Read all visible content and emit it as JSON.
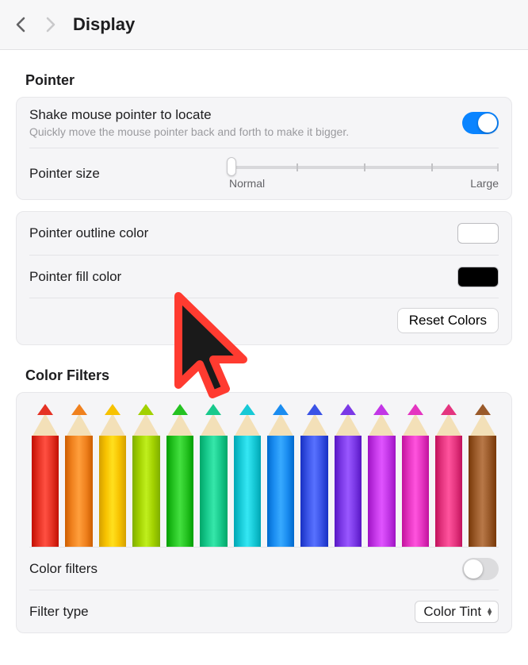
{
  "header": {
    "title": "Display"
  },
  "pointer": {
    "heading": "Pointer",
    "shake_label": "Shake mouse pointer to locate",
    "shake_sub": "Quickly move the mouse pointer back and forth to make it bigger.",
    "shake_on": true,
    "size_label": "Pointer size",
    "size_min_label": "Normal",
    "size_max_label": "Large",
    "outline_label": "Pointer outline color",
    "fill_label": "Pointer fill color",
    "reset_label": "Reset Colors"
  },
  "filters": {
    "heading": "Color Filters",
    "pencil_colors": [
      "#e53224",
      "#f0811e",
      "#f7c200",
      "#a2d100",
      "#25c221",
      "#18c98c",
      "#17c9d6",
      "#1a8cf0",
      "#3a53e6",
      "#7b39e6",
      "#c236e6",
      "#e435c0",
      "#e4357f",
      "#9a5a2a"
    ],
    "toggle_label": "Color filters",
    "toggle_on": false,
    "type_label": "Filter type",
    "type_value": "Color Tint"
  }
}
